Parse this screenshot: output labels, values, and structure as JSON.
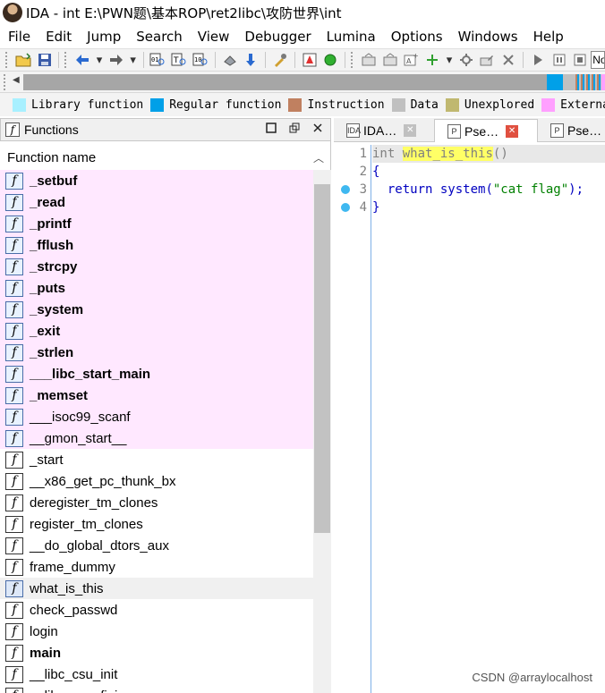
{
  "window": {
    "title": "IDA - int E:\\PWN题\\基本ROP\\ret2libc\\攻防世界\\int"
  },
  "menu": [
    "File",
    "Edit",
    "Jump",
    "Search",
    "View",
    "Debugger",
    "Lumina",
    "Options",
    "Windows",
    "Help"
  ],
  "toolbar": {
    "combo_value": "No"
  },
  "legend": [
    {
      "label": "Library function",
      "color": "#a8f0ff"
    },
    {
      "label": "Regular function",
      "color": "#00a0e8"
    },
    {
      "label": "Instruction",
      "color": "#c08060"
    },
    {
      "label": "Data",
      "color": "#c0c0c0"
    },
    {
      "label": "Unexplored",
      "color": "#c0b870"
    },
    {
      "label": "External symbol",
      "color": "#ffa0ff"
    }
  ],
  "functions_panel": {
    "title": "Functions",
    "column_header": "Function name",
    "icon_glyph": "f",
    "items": [
      {
        "name": "_setbuf",
        "kind": "lib",
        "bold": true
      },
      {
        "name": "_read",
        "kind": "lib",
        "bold": true
      },
      {
        "name": "_printf",
        "kind": "lib",
        "bold": true
      },
      {
        "name": "_fflush",
        "kind": "lib",
        "bold": true
      },
      {
        "name": "_strcpy",
        "kind": "lib",
        "bold": true
      },
      {
        "name": "_puts",
        "kind": "lib",
        "bold": true
      },
      {
        "name": "_system",
        "kind": "lib",
        "bold": true
      },
      {
        "name": "_exit",
        "kind": "lib",
        "bold": true
      },
      {
        "name": "_strlen",
        "kind": "lib",
        "bold": true
      },
      {
        "name": "___libc_start_main",
        "kind": "lib",
        "bold": true
      },
      {
        "name": "_memset",
        "kind": "lib",
        "bold": true
      },
      {
        "name": "___isoc99_scanf",
        "kind": "lib",
        "bold": false
      },
      {
        "name": "__gmon_start__",
        "kind": "lib",
        "bold": false
      },
      {
        "name": "_start",
        "kind": "regular",
        "bold": false
      },
      {
        "name": "__x86_get_pc_thunk_bx",
        "kind": "regular",
        "bold": false
      },
      {
        "name": "deregister_tm_clones",
        "kind": "regular",
        "bold": false
      },
      {
        "name": "register_tm_clones",
        "kind": "regular",
        "bold": false
      },
      {
        "name": "__do_global_dtors_aux",
        "kind": "regular",
        "bold": false
      },
      {
        "name": "frame_dummy",
        "kind": "regular",
        "bold": false
      },
      {
        "name": "what_is_this",
        "kind": "selected",
        "bold": false
      },
      {
        "name": "check_passwd",
        "kind": "regular",
        "bold": false
      },
      {
        "name": "login",
        "kind": "regular",
        "bold": false
      },
      {
        "name": "main",
        "kind": "regular",
        "bold": true
      },
      {
        "name": "__libc_csu_init",
        "kind": "regular",
        "bold": false
      },
      {
        "name": "__libc_csu_fini",
        "kind": "regular",
        "bold": false
      }
    ]
  },
  "tabs": [
    {
      "label": "IDA…",
      "icon": "IDA",
      "close_color": "#c0c0c0",
      "active": false
    },
    {
      "label": "Pse…",
      "icon": "P",
      "close_color": "#e05040",
      "active": true
    },
    {
      "label": "Pse…",
      "icon": "P",
      "close_color": "",
      "active": false
    }
  ],
  "code": {
    "line_numbers": [
      "1",
      "2",
      "3",
      "4"
    ],
    "breakpoint_lines": [
      3,
      4
    ],
    "line1": {
      "type": "int",
      "func": "what_is_this",
      "parens": "()"
    },
    "line2": "{",
    "line3": {
      "kw": "return",
      "call": " system(",
      "str": "\"cat flag\"",
      "end": ");"
    },
    "line4": "}"
  },
  "watermark": "CSDN @arraylocalhost"
}
